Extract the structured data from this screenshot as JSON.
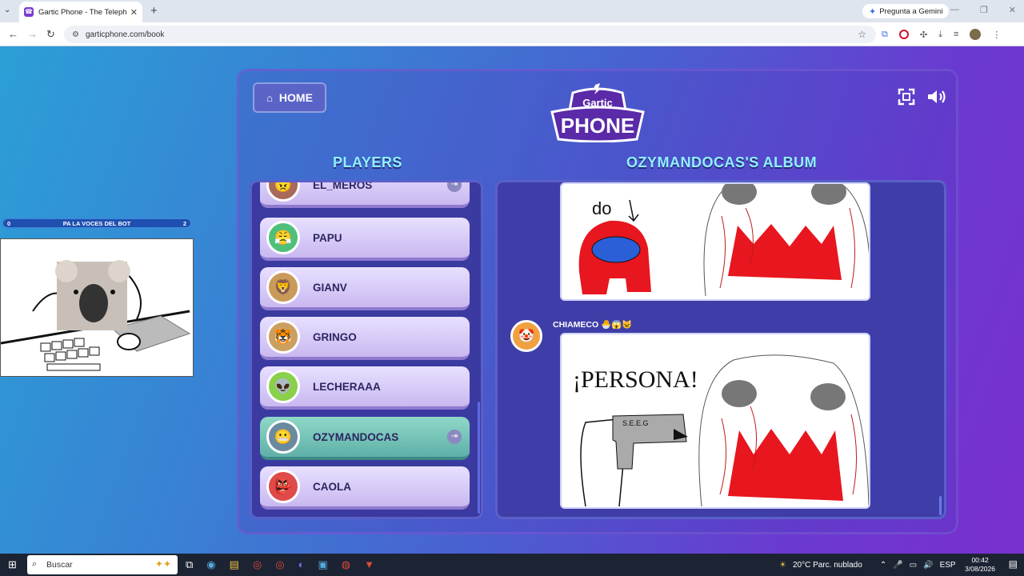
{
  "browser": {
    "tab_title": "Gartic Phone - The Telephone G",
    "url": "garticphone.com/book",
    "gemini_label": "Pregunta a Gemini"
  },
  "game": {
    "home_label": "HOME",
    "logo_top": "Gartic",
    "logo_main": "PHONE",
    "players_title": "PLAYERS",
    "album_title": "OZYMANDOCAS'S ALBUM",
    "players": [
      {
        "name": "EL_MEROS",
        "avatar_color": "#a86a5a",
        "icon": "😠"
      },
      {
        "name": "PAPU",
        "avatar_color": "#4fc07a",
        "icon": "😤"
      },
      {
        "name": "GIANV",
        "avatar_color": "#c99a5a",
        "icon": "🦁"
      },
      {
        "name": "GRINGO",
        "avatar_color": "#caa060",
        "icon": "🐯"
      },
      {
        "name": "LECHERAAA",
        "avatar_color": "#8ad04a",
        "icon": "👽"
      },
      {
        "name": "OZYMANDOCAS",
        "avatar_color": "#6a8aa0",
        "icon": "😬"
      },
      {
        "name": "CAOLA",
        "avatar_color": "#e04a4a",
        "icon": "👺"
      }
    ],
    "album": {
      "commenter": "CHIAMECO",
      "commenter_reactions": "🐣😱😺",
      "drawing_text": "¡PERSONA!",
      "gun_text": "S.E.E.G",
      "top_drawing_text": "do"
    }
  },
  "overlay": {
    "bar_left": "0",
    "bar_title": "PA LA VOCES DEL BOT",
    "bar_right": "2"
  },
  "taskbar": {
    "search_label": "Buscar",
    "weather": "20°C  Parc. nublado",
    "lang": "ESP",
    "time": "00:42",
    "date": "3/08/2026"
  }
}
